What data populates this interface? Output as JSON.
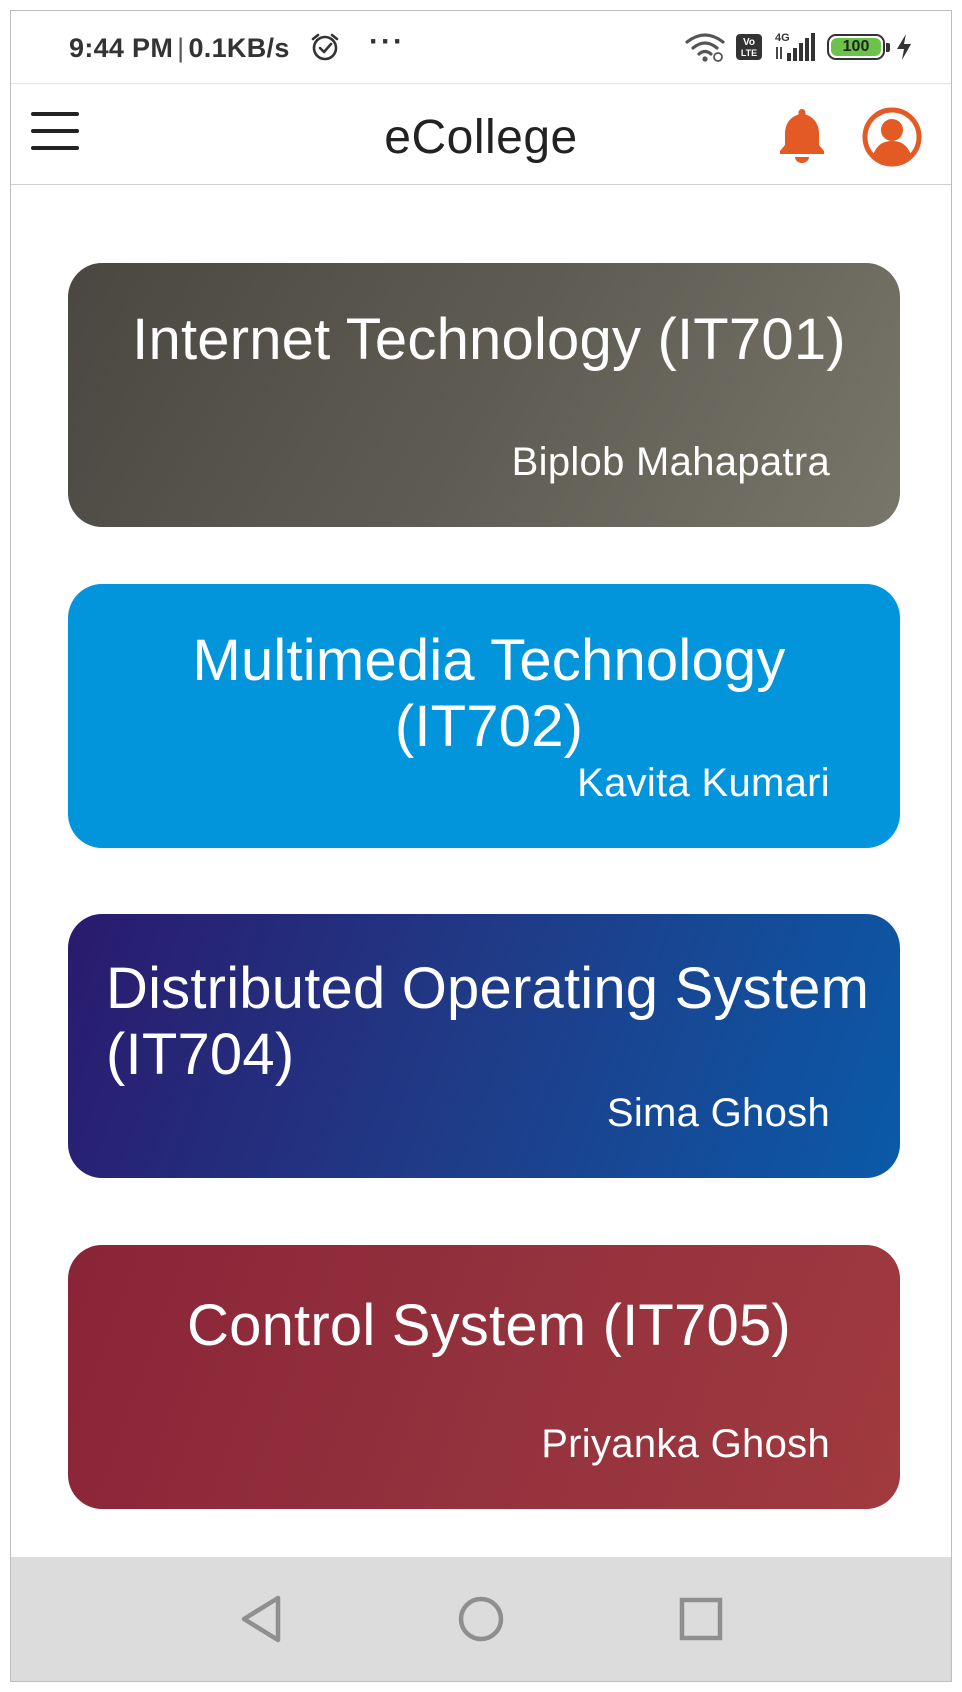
{
  "status_bar": {
    "time": "9:44 PM",
    "separator": "|",
    "speed": "0.1KB/s",
    "more": "···",
    "network": "4G",
    "volte": "Vo LTE",
    "battery": "100",
    "battery_level_percent": 100
  },
  "app_bar": {
    "title": "eCollege",
    "menu_icon": "hamburger-menu-icon",
    "notification_icon": "bell-icon",
    "profile_icon": "user-account-icon"
  },
  "courses": [
    {
      "title": "Internet Technology (IT701)",
      "teacher": "Biplob Mahapatra",
      "color": "#5e5c52"
    },
    {
      "title": "Multimedia Technology (IT702)",
      "teacher": "Kavita Kumari",
      "color": "#0395dc"
    },
    {
      "title": "Distributed Operating System (IT704)",
      "teacher": "Sima Ghosh",
      "color": "#1f3c88"
    },
    {
      "title": "Control System (IT705)",
      "teacher": "Priyanka Ghosh",
      "color": "#93313d"
    }
  ],
  "nav_bar": {
    "back_icon": "back-triangle-icon",
    "home_icon": "home-circle-icon",
    "recents_icon": "recents-square-icon"
  },
  "colors": {
    "accent": "#e35a24",
    "battery": "#6cc24a",
    "nav_bar_bg": "#dcdcdc"
  }
}
